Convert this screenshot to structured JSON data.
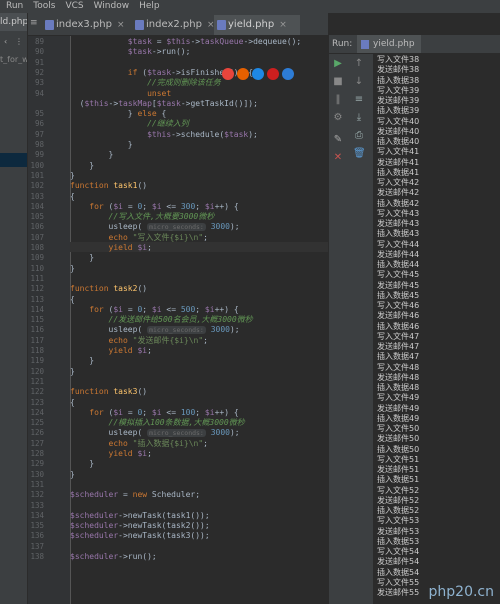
{
  "menubar": {
    "items": [
      "Run",
      "Tools",
      "VCS",
      "Window",
      "Help"
    ]
  },
  "project_tab": {
    "label": "ld.php",
    "file": "t_for_w"
  },
  "editor_tabs": [
    {
      "label": "index3.php",
      "active": false
    },
    {
      "label": "index2.php",
      "active": false
    },
    {
      "label": "yield.php",
      "active": true
    }
  ],
  "editor_lines": [
    {
      "n": "89",
      "html": "            <span class='var'>$task</span> = <span class='var'>$this</span>-><span class='var'>taskQueue</span>->dequeue();"
    },
    {
      "n": "90",
      "html": "            <span class='var'>$task</span>->run();"
    },
    {
      "n": "91",
      "html": ""
    },
    {
      "n": "92",
      "html": "            <span class='kw'>if</span> (<span class='var'>$task</span>->isFinished()) {"
    },
    {
      "n": "93",
      "html": "                <span class='cm'>//完成则删除该任务</span>"
    },
    {
      "n": "94",
      "html": "                <span class='kw'>unset</span>"
    },
    {
      "n": "",
      "html": "  (<span class='var'>$this</span>-><span class='var'>taskMap</span>[<span class='var'>$task</span>->getTaskId()]);"
    },
    {
      "n": "95",
      "html": "            } <span class='kw'>else</span> {"
    },
    {
      "n": "96",
      "html": "                <span class='cm'>//继续入列</span>"
    },
    {
      "n": "97",
      "html": "                <span class='var'>$this</span>->schedule(<span class='var'>$task</span>);"
    },
    {
      "n": "98",
      "html": "            }"
    },
    {
      "n": "99",
      "html": "        }"
    },
    {
      "n": "100",
      "html": "    }"
    },
    {
      "n": "101",
      "html": "}"
    },
    {
      "n": "102",
      "html": "<span class='kw'>function</span> <span class='fn'>task1</span>()"
    },
    {
      "n": "103",
      "html": "{"
    },
    {
      "n": "104",
      "html": "    <span class='kw'>for</span> (<span class='var'>$i</span> = <span class='num'>0</span>; <span class='var'>$i</span> &lt;= <span class='num'>300</span>; <span class='var'>$i</span>++) {"
    },
    {
      "n": "105",
      "html": "        <span class='cm'>//写入文件,大概要3000微秒</span>"
    },
    {
      "n": "106",
      "html": "        usleep( <span class='hint'>micro_seconds:</span> <span class='num'>3000</span>);"
    },
    {
      "n": "107",
      "html": "        <span class='kw'>echo</span> <span class='str'>\"写入文件{$i}\\n\"</span>;"
    },
    {
      "n": "108",
      "html": "        <span class='kw'>yield</span> <span class='var'>$i</span>;"
    },
    {
      "n": "109",
      "html": "    }"
    },
    {
      "n": "110",
      "html": "}"
    },
    {
      "n": "111",
      "html": ""
    },
    {
      "n": "112",
      "html": "<span class='kw'>function</span> <span class='fn'>task2</span>()"
    },
    {
      "n": "113",
      "html": "{"
    },
    {
      "n": "114",
      "html": "    <span class='kw'>for</span> (<span class='var'>$i</span> = <span class='num'>0</span>; <span class='var'>$i</span> &lt;= <span class='num'>500</span>; <span class='var'>$i</span>++) {"
    },
    {
      "n": "115",
      "html": "        <span class='cm'>//发送邮件给500名会员,大概3000微秒</span>"
    },
    {
      "n": "116",
      "html": "        usleep( <span class='hint'>micro_seconds:</span> <span class='num'>3000</span>);"
    },
    {
      "n": "117",
      "html": "        <span class='kw'>echo</span> <span class='str'>\"发送邮件{$i}\\n\"</span>;"
    },
    {
      "n": "118",
      "html": "        <span class='kw'>yield</span> <span class='var'>$i</span>;"
    },
    {
      "n": "119",
      "html": "    }"
    },
    {
      "n": "120",
      "html": "}"
    },
    {
      "n": "121",
      "html": ""
    },
    {
      "n": "122",
      "html": "<span class='kw'>function</span> <span class='fn'>task3</span>()"
    },
    {
      "n": "123",
      "html": "{"
    },
    {
      "n": "124",
      "html": "    <span class='kw'>for</span> (<span class='var'>$i</span> = <span class='num'>0</span>; <span class='var'>$i</span> &lt;= <span class='num'>100</span>; <span class='var'>$i</span>++) {"
    },
    {
      "n": "125",
      "html": "        <span class='cm'>//模拟插入100条数据,大概3000微秒</span>"
    },
    {
      "n": "126",
      "html": "        usleep( <span class='hint'>micro_seconds:</span> <span class='num'>3000</span>);"
    },
    {
      "n": "127",
      "html": "        <span class='kw'>echo</span> <span class='str'>\"插入数据{$i}\\n\"</span>;"
    },
    {
      "n": "128",
      "html": "        <span class='kw'>yield</span> <span class='var'>$i</span>;"
    },
    {
      "n": "129",
      "html": "    }"
    },
    {
      "n": "130",
      "html": "}"
    },
    {
      "n": "131",
      "html": ""
    },
    {
      "n": "132",
      "html": "<span class='var'>$scheduler</span> = <span class='kw'>new</span> Scheduler;"
    },
    {
      "n": "133",
      "html": ""
    },
    {
      "n": "134",
      "html": "<span class='var'>$scheduler</span>->newTask(task1());"
    },
    {
      "n": "135",
      "html": "<span class='var'>$scheduler</span>->newTask(task2());"
    },
    {
      "n": "136",
      "html": "<span class='var'>$scheduler</span>->newTask(task3());"
    },
    {
      "n": "137",
      "html": ""
    },
    {
      "n": "138",
      "html": "<span class='var'>$scheduler</span>->run();"
    }
  ],
  "run_panel": {
    "label": "Run:",
    "tab": "yield.php"
  },
  "output_lines": [
    "写入文件38",
    "发送邮件38",
    "插入数据38",
    "写入文件39",
    "发送邮件39",
    "插入数据39",
    "写入文件40",
    "发送邮件40",
    "插入数据40",
    "写入文件41",
    "发送邮件41",
    "插入数据41",
    "写入文件42",
    "发送邮件42",
    "插入数据42",
    "写入文件43",
    "发送邮件43",
    "插入数据43",
    "写入文件44",
    "发送邮件44",
    "插入数据44",
    "写入文件45",
    "发送邮件45",
    "插入数据45",
    "写入文件46",
    "发送邮件46",
    "插入数据46",
    "写入文件47",
    "发送邮件47",
    "插入数据47",
    "写入文件48",
    "发送邮件48",
    "插入数据48",
    "写入文件49",
    "发送邮件49",
    "插入数据49",
    "写入文件50",
    "发送邮件50",
    "插入数据50",
    "写入文件51",
    "发送邮件51",
    "插入数据51",
    "写入文件52",
    "发送邮件52",
    "插入数据52",
    "写入文件53",
    "发送邮件53",
    "插入数据53",
    "写入文件54",
    "发送邮件54",
    "插入数据54",
    "写入文件55",
    "发送邮件55"
  ],
  "watermark": "php20.cn"
}
